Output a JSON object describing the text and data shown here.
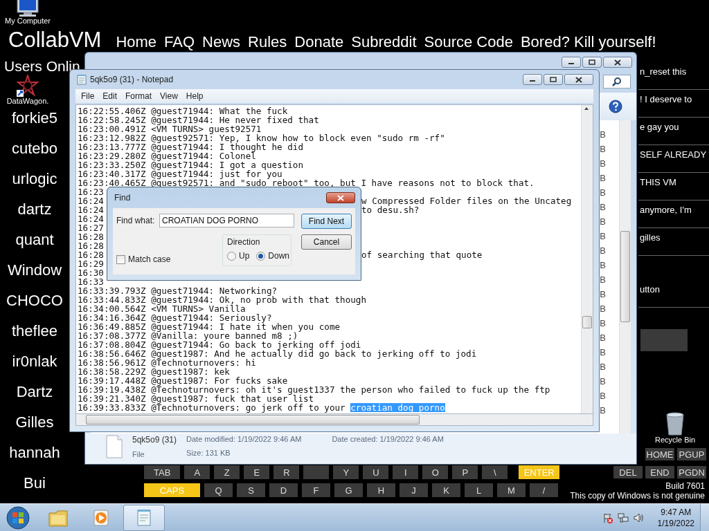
{
  "site_nav": {
    "logo": "CollabVM",
    "links": [
      "Home",
      "FAQ",
      "News",
      "Rules",
      "Donate",
      "Subreddit",
      "Source Code",
      "Bored? Kill yourself!"
    ]
  },
  "users_panel": {
    "heading": "Users Onlin",
    "users": [
      "forkie5",
      "cutebo",
      "urlogic",
      "dartz",
      "quant",
      "Window",
      "CHOCO",
      "theflee",
      "ir0nlak",
      "Dartz",
      "Gilles",
      "hannah",
      "Bui"
    ]
  },
  "chat_fragments": [
    "n_reset this",
    "! I deserve to",
    "e gay you",
    "SELF ALREADY",
    "THIS VM",
    "anymore, I'm",
    "gilles",
    "utton"
  ],
  "desktop_icons": [
    {
      "label": "My Computer",
      "kind": "computer"
    },
    {
      "label": "DataWagon.",
      "kind": "shortcut"
    },
    {
      "label": "Recycle Bin",
      "kind": "recycle"
    }
  ],
  "explorer": {
    "size_fragments": [
      "B",
      "B",
      "B",
      "B",
      "B",
      "B",
      "B",
      "B",
      "B",
      "B",
      "B",
      "B",
      "B",
      "B",
      "B",
      "B",
      "B",
      "B",
      "B",
      "B"
    ],
    "details": {
      "name": "5qk5o9 (31)",
      "modified": "Date modified: 1/19/2022 9:46 AM",
      "created": "Date created: 1/19/2022 9:46 AM",
      "type": "File",
      "size": "Size: 131 KB"
    }
  },
  "notepad": {
    "title": "5qk5o9 (31) - Notepad",
    "menu": [
      "File",
      "Edit",
      "Format",
      "View",
      "Help"
    ],
    "lines": [
      {
        "text": "16:22:55.406Z @guest71944: What the fuck"
      },
      {
        "text": "16:22:58.245Z @guest71944: He never fixed that"
      },
      {
        "text": "16:23:00.491Z <VM TURNS> guest92571"
      },
      {
        "text": "16:23:12.982Z @guest92571: Yep, I know how to block even \"sudo rm -rf\""
      },
      {
        "text": "16:23:13.777Z @guest71944: I thought he did"
      },
      {
        "text": "16:23:29.280Z @guest71944: Colonel"
      },
      {
        "text": "16:23:33.250Z @guest71944: I got a question"
      },
      {
        "text": "16:23:40.317Z @guest71944: just for you"
      },
      {
        "text": "16:23:40.465Z @guest92571: and \"sudo reboot\" too, but I have reasons not to block that."
      },
      {
        "text": "16:23"
      },
      {
        "text": "16:24",
        "tail": "w Compressed Folder files on the Uncateg"
      },
      {
        "text": "16:24",
        "tail": "to desu.sh?"
      },
      {
        "text": "16:24"
      },
      {
        "text": "16:27"
      },
      {
        "text": "16:28"
      },
      {
        "text": "16:28"
      },
      {
        "text": "16:28",
        "tail": "of searching that quote"
      },
      {
        "text": "16:29"
      },
      {
        "text": "16:30"
      },
      {
        "text": "16:33"
      },
      {
        "text": "16:33:39.793Z @guest71944: Networking?"
      },
      {
        "text": "16:33:44.833Z @guest71944: Ok, no prob with that though"
      },
      {
        "text": "16:34:00.564Z <VM TURNS> Vanilla"
      },
      {
        "text": "16:34:16.364Z @guest71944: Seriously?"
      },
      {
        "text": "16:36:49.885Z @guest71944: I hate it when you come"
      },
      {
        "text": "16:37:08.377Z @Vanilla: youre banned m8 ;)"
      },
      {
        "text": "16:37:08.804Z @guest71944: Go back to jerking off jodi"
      },
      {
        "text": "16:38:56.646Z @guest1987: And he actually did go back to jerking off to jodi"
      },
      {
        "text": "16:38:56.961Z @Technoturnovers: hi"
      },
      {
        "text": "16:38:58.229Z @guest1987: kek"
      },
      {
        "text": "16:39:17.448Z @guest1987: For fucks sake"
      },
      {
        "text": "16:39:19.438Z @Technoturnovers: oh it's guest1337 the person who failed to fuck up the ftp"
      },
      {
        "text": "16:39:21.340Z @guest1987: fuck that user list"
      },
      {
        "text": "16:39:33.833Z @Technoturnovers: go jerk off to your ",
        "highlight": "croatian dog porno"
      }
    ]
  },
  "find_dialog": {
    "title": "Find",
    "find_label": "Find what:",
    "find_value": "CROATIAN DOG PORNO",
    "buttons": [
      {
        "label": "Find Next",
        "default": true
      },
      {
        "label": "Cancel",
        "default": false
      }
    ],
    "match_case": {
      "label": "Match case",
      "checked": false
    },
    "direction": {
      "label": "Direction",
      "options": [
        {
          "label": "Up",
          "selected": false
        },
        {
          "label": "Down",
          "selected": true
        }
      ]
    }
  },
  "keyboard": {
    "nav_cluster": [
      [
        {
          "label": "HOME",
          "kind": "nav",
          "highlighted": false
        },
        {
          "label": "PGUP",
          "kind": "nav",
          "highlighted": false
        }
      ],
      [
        {
          "label": "DEL",
          "kind": "nav",
          "highlighted": false
        },
        {
          "label": "END",
          "kind": "nav",
          "highlighted": false
        },
        {
          "label": "PGDN",
          "kind": "nav",
          "highlighted": false
        }
      ]
    ],
    "upper_row": [
      {
        "label": "TAB",
        "kind": "wide",
        "highlighted": false
      },
      {
        "label": "A",
        "kind": "letter",
        "highlighted": false
      },
      {
        "label": "Z",
        "kind": "letter",
        "highlighted": false
      },
      {
        "label": "E",
        "kind": "letter",
        "highlighted": false
      },
      {
        "label": "R",
        "kind": "letter",
        "highlighted": false
      },
      {
        "kind": "blank",
        "highlighted": false
      },
      {
        "label": "Y",
        "kind": "letter",
        "highlighted": false
      },
      {
        "label": "U",
        "kind": "letter",
        "highlighted": false
      },
      {
        "label": "I",
        "kind": "letter",
        "highlighted": false
      },
      {
        "label": "O",
        "kind": "letter",
        "highlighted": false
      },
      {
        "label": "P",
        "kind": "letter",
        "highlighted": false
      },
      {
        "label": "\\",
        "kind": "letter",
        "highlighted": false
      },
      {
        "label": "ENTER",
        "kind": "enter",
        "highlighted": true
      }
    ],
    "middle_row": [
      {
        "label": "CAPS",
        "kind": "wide",
        "highlighted": true
      },
      {
        "label": "Q",
        "kind": "letter",
        "highlighted": false
      },
      {
        "label": "S",
        "kind": "letter",
        "highlighted": false
      },
      {
        "label": "D",
        "kind": "letter",
        "highlighted": false
      },
      {
        "label": "F",
        "kind": "letter",
        "highlighted": false
      },
      {
        "label": "G",
        "kind": "letter",
        "highlighted": false
      },
      {
        "label": "H",
        "kind": "letter",
        "highlighted": false
      },
      {
        "label": "J",
        "kind": "letter",
        "highlighted": false
      },
      {
        "label": "K",
        "kind": "letter",
        "highlighted": false
      },
      {
        "label": "L",
        "kind": "letter",
        "highlighted": false
      },
      {
        "label": "M",
        "kind": "letter",
        "highlighted": false
      },
      {
        "label": "/",
        "kind": "letter",
        "highlighted": false
      }
    ]
  },
  "windows_notice": [
    "Build 7601",
    "This copy of Windows is not genuine"
  ],
  "taskbar": {
    "buttons": [
      {
        "kind": "explorer",
        "active": false
      },
      {
        "kind": "media",
        "active": false
      },
      {
        "kind": "notepad",
        "active": true
      }
    ],
    "time": "9:47 AM",
    "date": "1/19/2022"
  }
}
